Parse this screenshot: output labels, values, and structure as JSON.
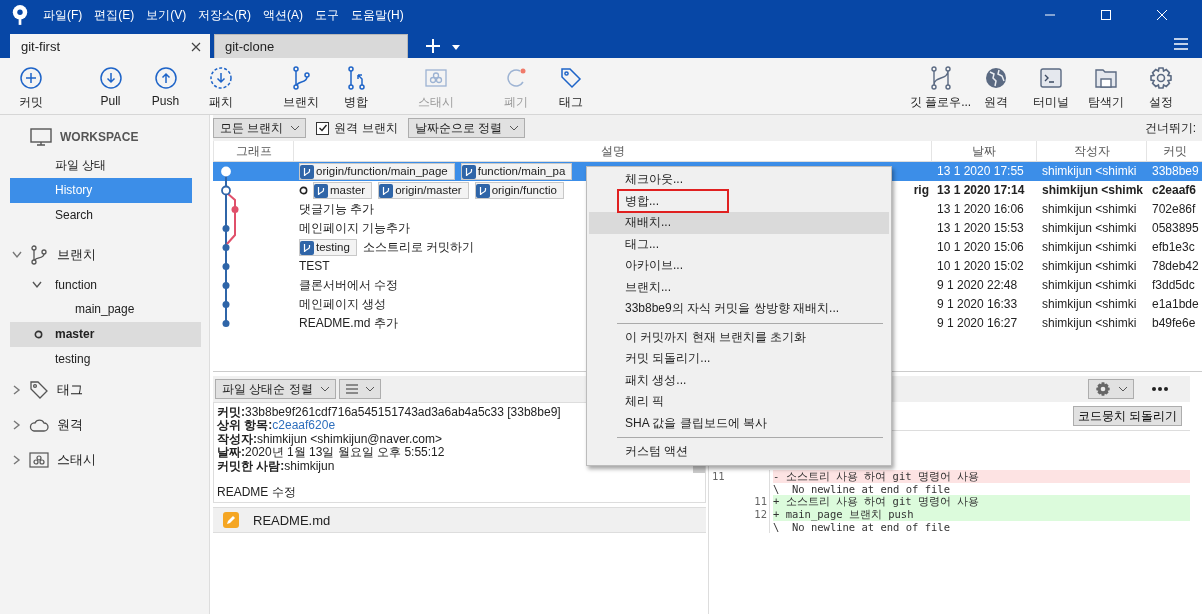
{
  "app_menu": [
    "파일(F)",
    "편집(E)",
    "보기(V)",
    "저장소(R)",
    "액션(A)",
    "도구",
    "도움말(H)"
  ],
  "tabs": [
    {
      "label": "git-first",
      "selected": true
    },
    {
      "label": "git-clone",
      "selected": false
    }
  ],
  "toolbar": {
    "left": [
      {
        "label": "커밋",
        "disabled": false
      },
      {
        "label": "Pull",
        "disabled": false
      },
      {
        "label": "Push",
        "disabled": false
      },
      {
        "label": "패치",
        "disabled": false
      },
      {
        "label": "브랜치",
        "disabled": false
      },
      {
        "label": "병합",
        "disabled": false
      },
      {
        "label": "스태시",
        "disabled": true
      },
      {
        "label": "폐기",
        "disabled": true
      },
      {
        "label": "태그",
        "disabled": false
      }
    ],
    "right": [
      {
        "label": "깃 플로우...",
        "disabled": false
      },
      {
        "label": "원격",
        "disabled": false
      },
      {
        "label": "터미널",
        "disabled": false
      },
      {
        "label": "탐색기",
        "disabled": false
      },
      {
        "label": "설정",
        "disabled": false
      }
    ]
  },
  "sidebar": {
    "workspace": {
      "title": "WORKSPACE",
      "items": [
        {
          "label": "파일 상태",
          "selected": false
        },
        {
          "label": "History",
          "selected": true
        },
        {
          "label": "Search",
          "selected": false
        }
      ]
    },
    "sections": [
      {
        "label": "브랜치",
        "expanded": true,
        "children": [
          {
            "label": "function",
            "kind": "folder",
            "expanded": true,
            "children": [
              {
                "label": "main_page",
                "selected": false
              }
            ]
          },
          {
            "label": "master",
            "kind": "branch",
            "selected": true,
            "current": true
          },
          {
            "label": "testing",
            "kind": "branch",
            "selected": false,
            "current": false
          }
        ]
      },
      {
        "label": "태그",
        "expanded": false
      },
      {
        "label": "원격",
        "expanded": false
      },
      {
        "label": "스태시",
        "expanded": false
      }
    ]
  },
  "filter_bar": {
    "branch_filter": "모든 브랜치",
    "remote_branches": {
      "label": "원격 브랜치",
      "checked": true
    },
    "sort": "날짜순으로 정렬",
    "jump_label": "건너뛰기:"
  },
  "table": {
    "columns": [
      "그래프",
      "설명",
      "날짜",
      "작성자",
      "커밋"
    ],
    "rows": [
      {
        "hollow": true,
        "side_lane": false,
        "selected": true,
        "bold": false,
        "head": false,
        "refs": [
          "origin/function/main_page",
          "function/main_pa"
        ],
        "date": "13 1 2020 17:55",
        "author": "shimkijun <shimki",
        "hash": "33b8be9"
      },
      {
        "hollow": true,
        "side_lane": false,
        "selected": false,
        "bold": true,
        "head": true,
        "refs": [
          "master",
          "origin/master",
          "origin/functio"
        ],
        "tail": "rig",
        "date": "13 1 2020 17:14",
        "author": "shimkijun <shimk",
        "hash": "c2eaaf6"
      },
      {
        "hollow": false,
        "side_lane": true,
        "selected": false,
        "bold": false,
        "head": false,
        "message": "댓글기능 추가",
        "date": "13 1 2020 16:06",
        "author": "shimkijun <shimki",
        "hash": "702e86f"
      },
      {
        "hollow": false,
        "side_lane": false,
        "selected": false,
        "bold": false,
        "head": false,
        "message": "메인페이지 기능추가",
        "date": "13 1 2020 15:53",
        "author": "shimkijun <shimki",
        "hash": "0583895"
      },
      {
        "hollow": false,
        "side_lane": false,
        "selected": false,
        "bold": false,
        "head": false,
        "refs": [
          "testing"
        ],
        "message": "소스트리로 커밋하기",
        "date": "10 1 2020 15:06",
        "author": "shimkijun <shimki",
        "hash": "efb1e3c"
      },
      {
        "hollow": false,
        "side_lane": false,
        "selected": false,
        "bold": false,
        "head": false,
        "message": "TEST",
        "date": "10 1 2020 15:02",
        "author": "shimkijun <shimki",
        "hash": "78deb42"
      },
      {
        "hollow": false,
        "side_lane": false,
        "selected": false,
        "bold": false,
        "head": false,
        "message": "클론서버에서 수정",
        "date": "9 1 2020 22:48",
        "author": "shimkijun <shimki",
        "hash": "f3dd5dc"
      },
      {
        "hollow": false,
        "side_lane": false,
        "selected": false,
        "bold": false,
        "head": false,
        "message": "메인페이지 생성",
        "date": "9 1 2020 16:33",
        "author": "shimkijun <shimki",
        "hash": "e1a1bde"
      },
      {
        "hollow": false,
        "side_lane": false,
        "selected": false,
        "bold": false,
        "head": false,
        "message": "README.md 추가",
        "date": "9 1 2020 16:27",
        "author": "shimkijun <shimki",
        "hash": "b49fe6e"
      }
    ]
  },
  "details": {
    "sort": "파일 상태순 정렬",
    "fields": [
      {
        "label": "커밋:",
        "value": "33b8be9f261cdf716a545151743ad3a6ab4a5c33 [33b8be9]",
        "kind": "text"
      },
      {
        "label": "상위 항목:",
        "value": "c2eaaf620e",
        "kind": "link"
      },
      {
        "label": "작성자:",
        "value": "shimkijun <shimkijun@naver.com>",
        "kind": "text"
      },
      {
        "label": "날짜:",
        "value": "2020년 1월 13일 월요일 오후 5:55:12",
        "kind": "text"
      },
      {
        "label": "커밋한 사람:",
        "value": "shimkijun",
        "kind": "text"
      }
    ],
    "message": "README 수정",
    "files": [
      "README.md"
    ]
  },
  "diff": {
    "discard_hunk": "코드뭉치 되돌리기",
    "lines": [
      {
        "old": "11",
        "text": "- 소스트리 사용 하여 git 명령어 사용",
        "kind": "removed"
      },
      {
        "text": "\\  No newline at end of file",
        "kind": "context"
      },
      {
        "new": "11",
        "text": "+ 소스트리 사용 하여 git 명령어 사용",
        "kind": "added"
      },
      {
        "new": "12",
        "text": "+ main_page 브랜치 push",
        "kind": "added"
      },
      {
        "text": "\\  No newline at end of file",
        "kind": "context"
      }
    ]
  },
  "context_menu": [
    [
      {
        "label": "체크아웃...",
        "selected": false,
        "boxed": false
      },
      {
        "label": "병합...",
        "selected": false,
        "boxed": true
      },
      {
        "label": "재배치...",
        "selected": true,
        "boxed": false
      },
      {
        "label": "태그...",
        "selected": false,
        "boxed": false
      },
      {
        "label": "아카이브...",
        "selected": false,
        "boxed": false
      },
      {
        "label": "브랜치...",
        "selected": false,
        "boxed": false
      },
      {
        "label": "33b8be9의 자식 커밋을 쌍방향 재배치...",
        "selected": false,
        "boxed": false
      }
    ],
    [
      {
        "label": "이 커밋까지 현재 브랜치를 초기화",
        "selected": false,
        "boxed": false
      },
      {
        "label": "커밋 되돌리기...",
        "selected": false,
        "boxed": false
      },
      {
        "label": "패치 생성...",
        "selected": false,
        "boxed": false
      },
      {
        "label": "체리 픽",
        "selected": false,
        "boxed": false
      },
      {
        "label": "SHA 값을 클립보드에 복사",
        "selected": false,
        "boxed": false
      }
    ],
    [
      {
        "label": "커스텀 액션",
        "selected": false,
        "boxed": false
      }
    ]
  ]
}
